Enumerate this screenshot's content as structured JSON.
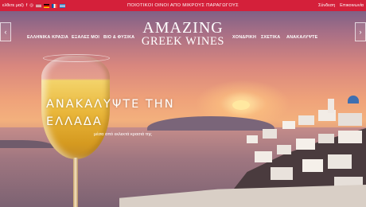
{
  "topbar": {
    "left_text": "ελθετε μαζι",
    "center_text": "ΠΟΙΟΤΙΚΟΙ ΟΙΝΟΙ ΑΠΟ ΜΙΚΡΟΥΣ ΠΑΡΑΓΩΓΟΥΣ",
    "login": "Σύνδεση",
    "contact": "Επικοινωνία",
    "social": [
      "f",
      "◎"
    ],
    "flags": [
      "en",
      "de",
      "fr",
      "gr"
    ],
    "bg_color": "#d4203a"
  },
  "logo": {
    "line1": "AMAZING",
    "line2": "GREEK WINES"
  },
  "nav": {
    "items": [
      "ΕΛΛΗΝΙΚΑ ΚΡΑΣΙΑ",
      "ΕΞΑΛΕΣ ΜΟΙ",
      "ΒΙΟ & ΦΥΣΙΚΑ",
      "ΧΟΝΔΡΙΚΗ",
      "ΣΧΕΤΙΚΑ",
      "ΑΝΑΚΑΛΥΨΤΕ"
    ],
    "prev_arrow": "‹",
    "next_arrow": "›"
  },
  "hero": {
    "line1": "ΑΝΑΚΑΛΥΨΤΕ ΤΗΝ",
    "line2": "ΕΛΛΑΔΑ",
    "subline": "μέσα από εκλεκτά κρασιά της"
  }
}
